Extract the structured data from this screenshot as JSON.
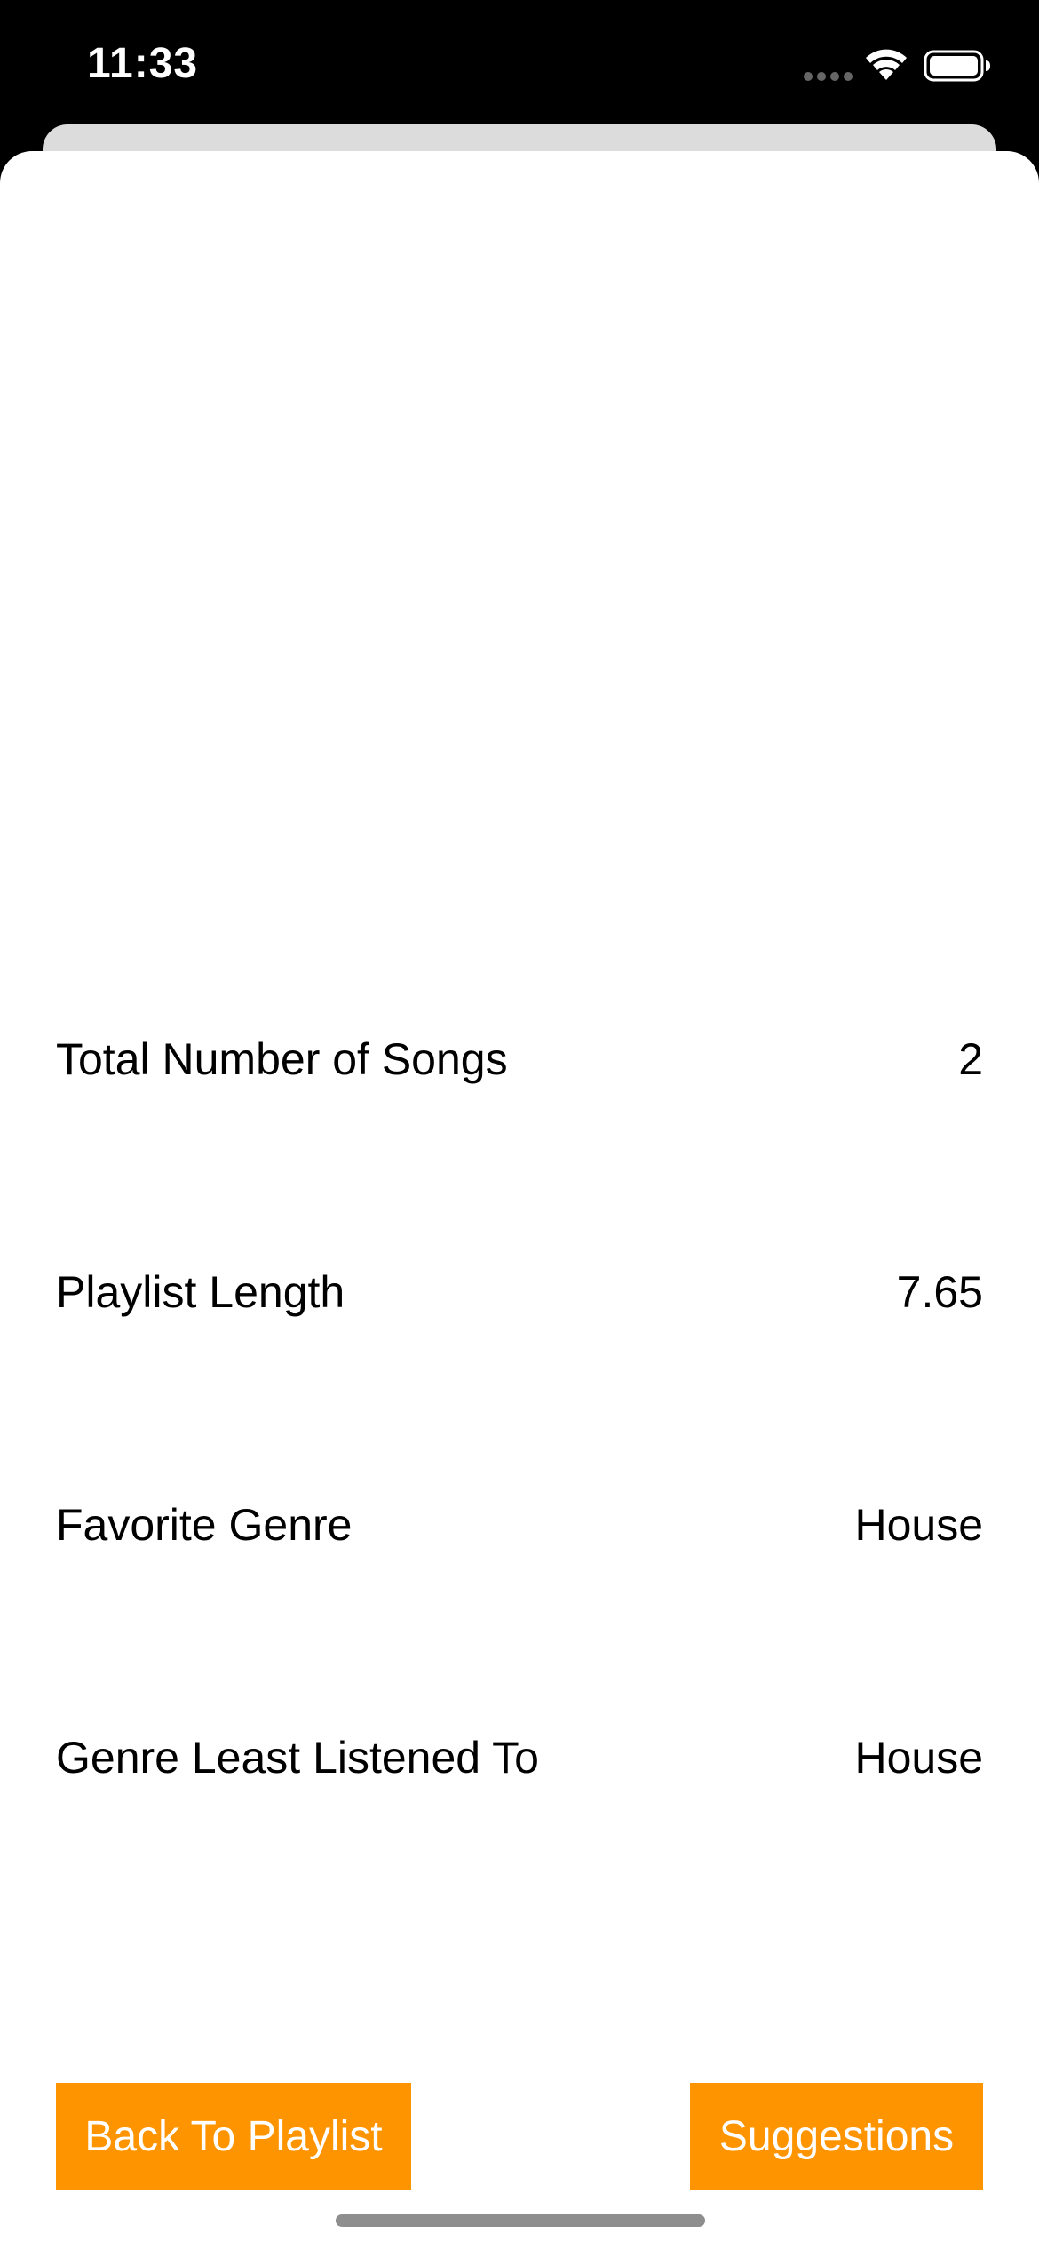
{
  "status_bar": {
    "time": "11:33",
    "icons": [
      "cellular-signal-icon",
      "wifi-icon",
      "battery-icon"
    ]
  },
  "stats": [
    {
      "label": "Total Number of Songs",
      "value": "2"
    },
    {
      "label": "Playlist Length",
      "value": "7.65"
    },
    {
      "label": "Favorite Genre",
      "value": "House"
    },
    {
      "label": "Genre Least Listened To",
      "value": "House"
    }
  ],
  "buttons": {
    "back_label": "Back To Playlist",
    "suggestions_label": "Suggestions"
  },
  "colors": {
    "accent": "#fe9400",
    "background": "#ffffff",
    "status_bar": "#000000"
  }
}
